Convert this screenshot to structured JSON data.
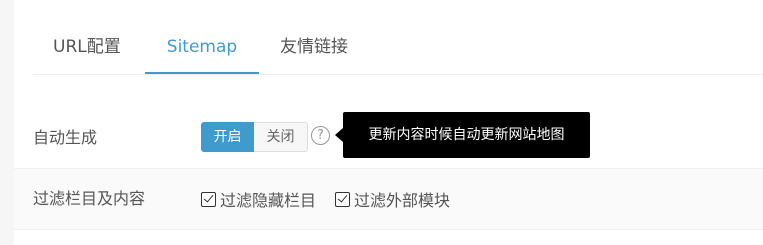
{
  "tabs": [
    {
      "label": "URL配置",
      "active": false
    },
    {
      "label": "Sitemap",
      "active": true
    },
    {
      "label": "友情链接",
      "active": false
    }
  ],
  "auto_generate": {
    "label": "自动生成",
    "on_label": "开启",
    "off_label": "关闭",
    "selected": "开启",
    "help_icon": "question-circle-icon",
    "tooltip": "更新内容时候自动更新网站地图"
  },
  "filter": {
    "label": "过滤栏目及内容",
    "options": [
      {
        "label": "过滤隐藏栏目",
        "checked": true
      },
      {
        "label": "过滤外部模块",
        "checked": true
      }
    ]
  },
  "colors": {
    "accent": "#3f9bcd",
    "tooltip_bg": "#000000",
    "text": "#555555"
  }
}
